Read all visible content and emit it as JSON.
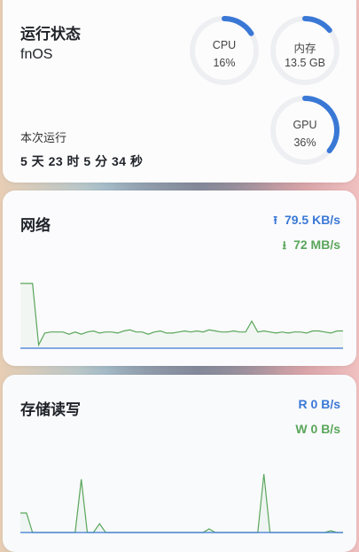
{
  "status": {
    "title": "运行状态",
    "os": "fnOS",
    "uptime_label": "本次运行",
    "uptime": "5 天 23 时 5 分 34 秒",
    "gauges": [
      {
        "name": "CPU",
        "value": "16%",
        "fraction": 0.16
      },
      {
        "name": "内存",
        "value": "13.5 GB",
        "fraction": 0.14
      },
      {
        "name": "GPU",
        "value": "36%",
        "fraction": 0.36
      }
    ]
  },
  "network": {
    "title": "网络",
    "upload": "79.5 KB/s",
    "download": "72 MB/s",
    "download_series": [
      60,
      60,
      60,
      3,
      14,
      15,
      15,
      15,
      13,
      15,
      13,
      15,
      16,
      14,
      15,
      15,
      14,
      16,
      17,
      15,
      15,
      13,
      15,
      16,
      14,
      14,
      15,
      16,
      15,
      16,
      15,
      17,
      16,
      15,
      15,
      16,
      15,
      15,
      25,
      15,
      16,
      15,
      14,
      15,
      14,
      15,
      15,
      14,
      16,
      16,
      15,
      14,
      16,
      16
    ],
    "upload_series": [
      0,
      0,
      0,
      0,
      0,
      0,
      0,
      0,
      0,
      0,
      0,
      0,
      0,
      0,
      0,
      0,
      0,
      0,
      0,
      0,
      0,
      0,
      0,
      0,
      0,
      0,
      0,
      0,
      0,
      0,
      0,
      0,
      0,
      0,
      0,
      0,
      0,
      0,
      0,
      0,
      0,
      0,
      0,
      0,
      0,
      0,
      0,
      0,
      0,
      0,
      0,
      0,
      0,
      0
    ]
  },
  "storage": {
    "title": "存储读写",
    "read": "R  0 B/s",
    "write": "W  0 B/s",
    "write_series": [
      22,
      22,
      0,
      0,
      0,
      0,
      0,
      0,
      0,
      0,
      60,
      0,
      0,
      10,
      0,
      0,
      0,
      0,
      0,
      0,
      0,
      0,
      0,
      0,
      0,
      0,
      0,
      0,
      0,
      0,
      0,
      4,
      0,
      0,
      0,
      0,
      0,
      0,
      0,
      0,
      66,
      0,
      0,
      0,
      0,
      0,
      0,
      0,
      0,
      0,
      0,
      2,
      0,
      0
    ],
    "read_series": [
      0,
      0,
      0,
      0,
      0,
      0,
      0,
      0,
      0,
      0,
      0,
      0,
      0,
      0,
      0,
      0,
      0,
      0,
      0,
      0,
      0,
      0,
      0,
      0,
      0,
      0,
      0,
      0,
      0,
      0,
      0,
      0,
      0,
      0,
      0,
      0,
      0,
      0,
      0,
      0,
      0,
      0,
      0,
      0,
      0,
      0,
      0,
      0,
      0,
      0,
      0,
      0,
      0,
      0
    ]
  },
  "colors": {
    "upload": "#3a78d6",
    "download": "#5aa65a",
    "gauge_track": "#eeeff2",
    "gauge_fill": "#3a78d6"
  }
}
